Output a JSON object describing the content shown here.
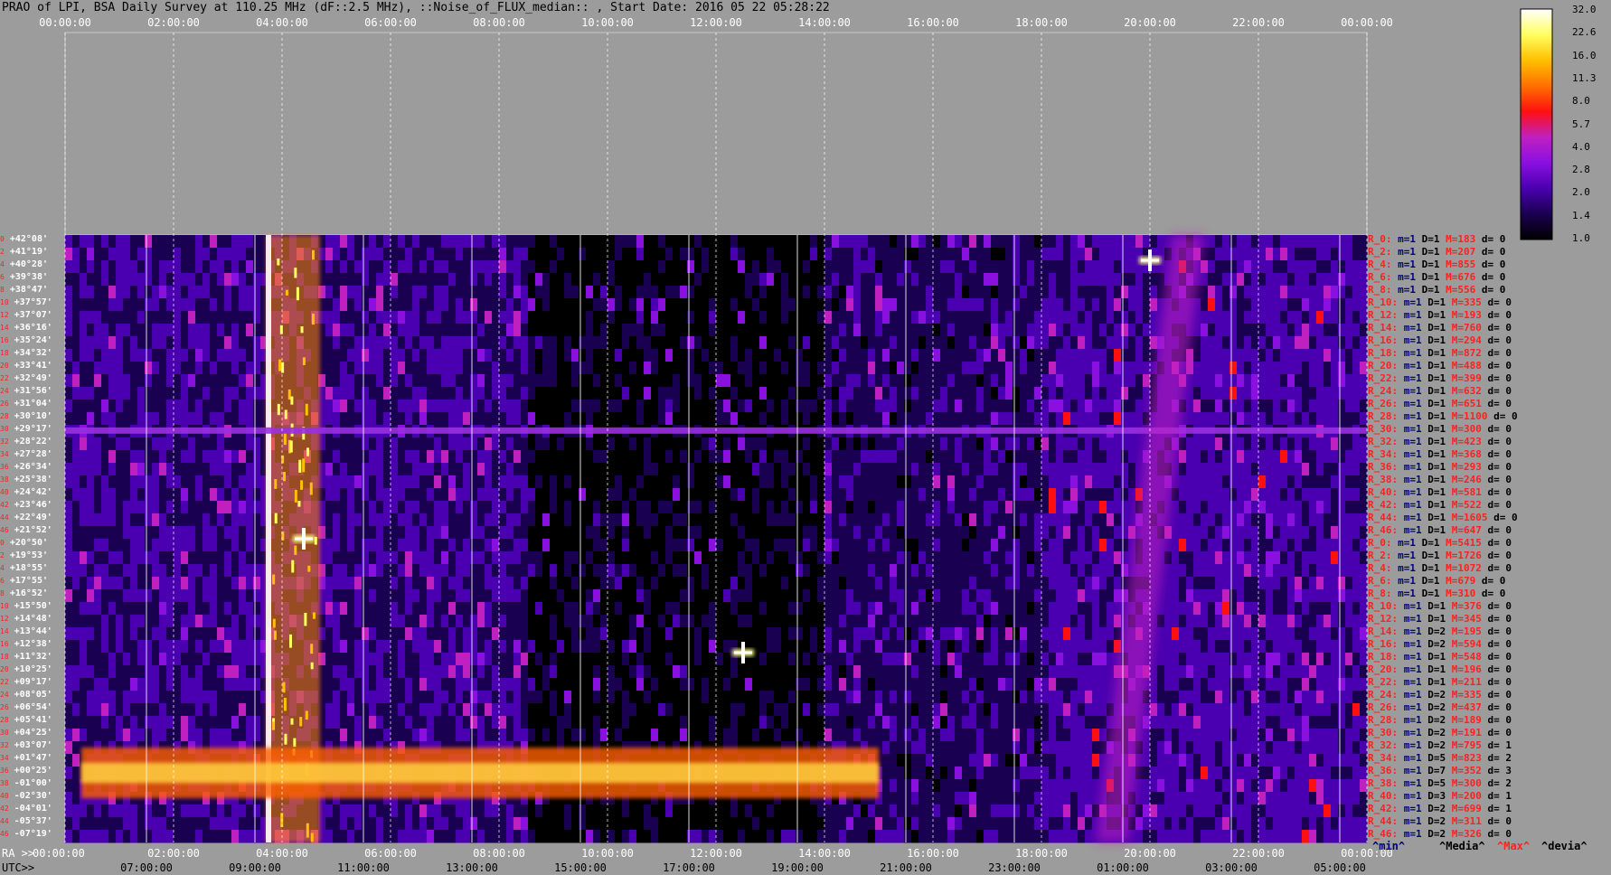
{
  "title": "PRAO of LPI, BSA Daily Survey at 110.25 MHz (dF::2.5 MHz), ::Noise_of_FLUX_median:: , Start Date: 2016 05 22 05:28:22",
  "top_ticks": [
    "00:00:00",
    "02:00:00",
    "04:00:00",
    "06:00:00",
    "08:00:00",
    "10:00:00",
    "12:00:00",
    "14:00:00",
    "16:00:00",
    "18:00:00",
    "20:00:00",
    "22:00:00",
    "00:00:00"
  ],
  "bottom": {
    "ra_label": "RA >>",
    "utc_label": "UTC>>",
    "ra_ticks": [
      "00:00:00",
      "02:00:00",
      "04:00:00",
      "06:00:00",
      "08:00:00",
      "10:00:00",
      "12:00:00",
      "14:00:00",
      "16:00:00",
      "18:00:00",
      "20:00:00",
      "22:00:00",
      "00:00:00"
    ],
    "utc_ticks": [
      "07:00:00",
      "09:00:00",
      "11:00:00",
      "13:00:00",
      "15:00:00",
      "17:00:00",
      "19:00:00",
      "21:00:00",
      "23:00:00",
      "01:00:00",
      "03:00:00",
      "05:00:00"
    ]
  },
  "colorbar": {
    "labels": [
      "32.0",
      "22.6",
      "16.0",
      "11.3",
      "8.0",
      "5.7",
      "4.0",
      "2.8",
      "2.0",
      "1.4",
      "1.0"
    ],
    "stops": [
      "#000000",
      "#1a0050",
      "#4a00b0",
      "#8a10e0",
      "#c020c0",
      "#ff1010",
      "#ff7000",
      "#ffc000",
      "#ffff60",
      "#ffffff"
    ]
  },
  "legend": {
    "min": "^min^",
    "median": "^Media^",
    "max": "^Max^",
    "dev": "^devia^"
  },
  "legend_colors": {
    "min": "#000080",
    "median": "#000000",
    "max": "#ff2020",
    "dev": "#000000"
  },
  "declinations": [
    "+42°08'",
    "+41°19'",
    "+40°28'",
    "+39°38'",
    "+38°47'",
    "+37°57'",
    "+37°07'",
    "+36°16'",
    "+35°24'",
    "+34°32'",
    "+33°41'",
    "+32°49'",
    "+31°56'",
    "+31°04'",
    "+30°10'",
    "+29°17'",
    "+28°22'",
    "+27°28'",
    "+26°34'",
    "+25°38'",
    "+24°42'",
    "+23°46'",
    "+22°49'",
    "+21°52'",
    "+20°50'",
    "+19°53'",
    "+18°55'",
    "+17°55'",
    "+16°52'",
    "+15°50'",
    "+14°48'",
    "+13°44'",
    "+12°38'",
    "+11°32'",
    "+10°25'",
    "+09°17'",
    "+08°05'",
    "+06°54'",
    "+05°41'",
    "+04°25'",
    "+03°07'",
    "+01°47'",
    "+00°25'",
    "-01°00'",
    "-02°30'",
    "-04°01'",
    "-05°37'",
    "-07°19'"
  ],
  "dec_indices": [
    "0",
    "2",
    "4",
    "6",
    "8",
    "10",
    "12",
    "14",
    "16",
    "18",
    "20",
    "22",
    "24",
    "26",
    "28",
    "30",
    "32",
    "34",
    "36",
    "38",
    "40",
    "42",
    "44",
    "46",
    "0",
    "2",
    "4",
    "6",
    "8",
    "10",
    "12",
    "14",
    "16",
    "18",
    "20",
    "22",
    "24",
    "26",
    "28",
    "30",
    "32",
    "34",
    "36",
    "38",
    "40",
    "42",
    "44",
    "46"
  ],
  "ray_stats": [
    {
      "r": "R_0:",
      "m": "m=1",
      "d": "D=1",
      "M": "M=183",
      "dv": "d= 0"
    },
    {
      "r": "R_2:",
      "m": "m=1",
      "d": "D=1",
      "M": "M=207",
      "dv": "d= 0"
    },
    {
      "r": "R_4:",
      "m": "m=1",
      "d": "D=1",
      "M": "M=855",
      "dv": "d= 0"
    },
    {
      "r": "R_6:",
      "m": "m=1",
      "d": "D=1",
      "M": "M=676",
      "dv": "d= 0"
    },
    {
      "r": "R_8:",
      "m": "m=1",
      "d": "D=1",
      "M": "M=556",
      "dv": "d= 0"
    },
    {
      "r": "R_10:",
      "m": "m=1",
      "d": "D=1",
      "M": "M=335",
      "dv": "d= 0"
    },
    {
      "r": "R_12:",
      "m": "m=1",
      "d": "D=1",
      "M": "M=193",
      "dv": "d= 0"
    },
    {
      "r": "R_14:",
      "m": "m=1",
      "d": "D=1",
      "M": "M=760",
      "dv": "d= 0"
    },
    {
      "r": "R_16:",
      "m": "m=1",
      "d": "D=1",
      "M": "M=294",
      "dv": "d= 0"
    },
    {
      "r": "R_18:",
      "m": "m=1",
      "d": "D=1",
      "M": "M=872",
      "dv": "d= 0"
    },
    {
      "r": "R_20:",
      "m": "m=1",
      "d": "D=1",
      "M": "M=488",
      "dv": "d= 0"
    },
    {
      "r": "R_22:",
      "m": "m=1",
      "d": "D=1",
      "M": "M=399",
      "dv": "d= 0"
    },
    {
      "r": "R_24:",
      "m": "m=1",
      "d": "D=1",
      "M": "M=632",
      "dv": "d= 0"
    },
    {
      "r": "R_26:",
      "m": "m=1",
      "d": "D=1",
      "M": "M=651",
      "dv": "d= 0"
    },
    {
      "r": "R_28:",
      "m": "m=1",
      "d": "D=1",
      "M": "M=1100",
      "dv": "d= 0"
    },
    {
      "r": "R_30:",
      "m": "m=1",
      "d": "D=1",
      "M": "M=300",
      "dv": "d= 0"
    },
    {
      "r": "R_32:",
      "m": "m=1",
      "d": "D=1",
      "M": "M=423",
      "dv": "d= 0"
    },
    {
      "r": "R_34:",
      "m": "m=1",
      "d": "D=1",
      "M": "M=368",
      "dv": "d= 0"
    },
    {
      "r": "R_36:",
      "m": "m=1",
      "d": "D=1",
      "M": "M=293",
      "dv": "d= 0"
    },
    {
      "r": "R_38:",
      "m": "m=1",
      "d": "D=1",
      "M": "M=246",
      "dv": "d= 0"
    },
    {
      "r": "R_40:",
      "m": "m=1",
      "d": "D=1",
      "M": "M=581",
      "dv": "d= 0"
    },
    {
      "r": "R_42:",
      "m": "m=1",
      "d": "D=1",
      "M": "M=522",
      "dv": "d= 0"
    },
    {
      "r": "R_44:",
      "m": "m=1",
      "d": "D=1",
      "M": "M=1605",
      "dv": "d= 0"
    },
    {
      "r": "R_46:",
      "m": "m=1",
      "d": "D=1",
      "M": "M=647",
      "dv": "d= 0"
    },
    {
      "r": "R_0:",
      "m": "m=1",
      "d": "D=1",
      "M": "M=5415",
      "dv": "d= 0"
    },
    {
      "r": "R_2:",
      "m": "m=1",
      "d": "D=1",
      "M": "M=1726",
      "dv": "d= 0"
    },
    {
      "r": "R_4:",
      "m": "m=1",
      "d": "D=1",
      "M": "M=1072",
      "dv": "d= 0"
    },
    {
      "r": "R_6:",
      "m": "m=1",
      "d": "D=1",
      "M": "M=679",
      "dv": "d= 0"
    },
    {
      "r": "R_8:",
      "m": "m=1",
      "d": "D=1",
      "M": "M=310",
      "dv": "d= 0"
    },
    {
      "r": "R_10:",
      "m": "m=1",
      "d": "D=1",
      "M": "M=376",
      "dv": "d= 0"
    },
    {
      "r": "R_12:",
      "m": "m=1",
      "d": "D=1",
      "M": "M=345",
      "dv": "d= 0"
    },
    {
      "r": "R_14:",
      "m": "m=1",
      "d": "D=2",
      "M": "M=195",
      "dv": "d= 0"
    },
    {
      "r": "R_16:",
      "m": "m=1",
      "d": "D=2",
      "M": "M=594",
      "dv": "d= 0"
    },
    {
      "r": "R_18:",
      "m": "m=1",
      "d": "D=1",
      "M": "M=548",
      "dv": "d= 0"
    },
    {
      "r": "R_20:",
      "m": "m=1",
      "d": "D=1",
      "M": "M=196",
      "dv": "d= 0"
    },
    {
      "r": "R_22:",
      "m": "m=1",
      "d": "D=1",
      "M": "M=211",
      "dv": "d= 0"
    },
    {
      "r": "R_24:",
      "m": "m=1",
      "d": "D=2",
      "M": "M=335",
      "dv": "d= 0"
    },
    {
      "r": "R_26:",
      "m": "m=1",
      "d": "D=2",
      "M": "M=437",
      "dv": "d= 0"
    },
    {
      "r": "R_28:",
      "m": "m=1",
      "d": "D=2",
      "M": "M=189",
      "dv": "d= 0"
    },
    {
      "r": "R_30:",
      "m": "m=1",
      "d": "D=2",
      "M": "M=191",
      "dv": "d= 0"
    },
    {
      "r": "R_32:",
      "m": "m=1",
      "d": "D=2",
      "M": "M=795",
      "dv": "d= 1"
    },
    {
      "r": "R_34:",
      "m": "m=1",
      "d": "D=5",
      "M": "M=823",
      "dv": "d= 2"
    },
    {
      "r": "R_36:",
      "m": "m=1",
      "d": "D=7",
      "M": "M=352",
      "dv": "d= 3"
    },
    {
      "r": "R_38:",
      "m": "m=1",
      "d": "D=5",
      "M": "M=300",
      "dv": "d= 2"
    },
    {
      "r": "R_40:",
      "m": "m=1",
      "d": "D=3",
      "M": "M=200",
      "dv": "d= 1"
    },
    {
      "r": "R_42:",
      "m": "m=1",
      "d": "D=2",
      "M": "M=699",
      "dv": "d= 1"
    },
    {
      "r": "R_44:",
      "m": "m=1",
      "d": "D=2",
      "M": "M=311",
      "dv": "d= 0"
    },
    {
      "r": "R_46:",
      "m": "m=1",
      "d": "D=2",
      "M": "M=326",
      "dv": "d= 0"
    }
  ],
  "chart_data": {
    "type": "heatmap",
    "title": "PRAO of LPI, BSA Daily Survey at 110.25 MHz (dF::2.5 MHz), ::Noise_of_FLUX_median:: , Start Date: 2016 05 22 05:28:22",
    "x_axis": "RA (hours, 0-24) / UTC",
    "y_axis": "Declination",
    "colorscale_range": [
      1.0,
      32.0
    ],
    "colorscale_log": true,
    "features": [
      {
        "kind": "vertical_band",
        "ra_hours": [
          3.7,
          4.7
        ],
        "level": "high"
      },
      {
        "kind": "horizontal_band",
        "dec_range": [
          "+01°47'",
          "-02°30'"
        ],
        "ra_hours": [
          0.3,
          15.0
        ],
        "level": "high"
      },
      {
        "kind": "horizontal_line",
        "dec": "+29°17'",
        "level": "medium"
      },
      {
        "kind": "source",
        "ra_hours": 20.0,
        "dec": "+40°28'",
        "level": "max"
      },
      {
        "kind": "source",
        "ra_hours": 4.4,
        "dec": "+20°50'",
        "level": "max"
      },
      {
        "kind": "diagonal_band",
        "ra_hours": [
          19.0,
          21.0
        ],
        "dec_range": [
          "-07°19'",
          "+42°08'"
        ],
        "level": "medium"
      }
    ]
  }
}
